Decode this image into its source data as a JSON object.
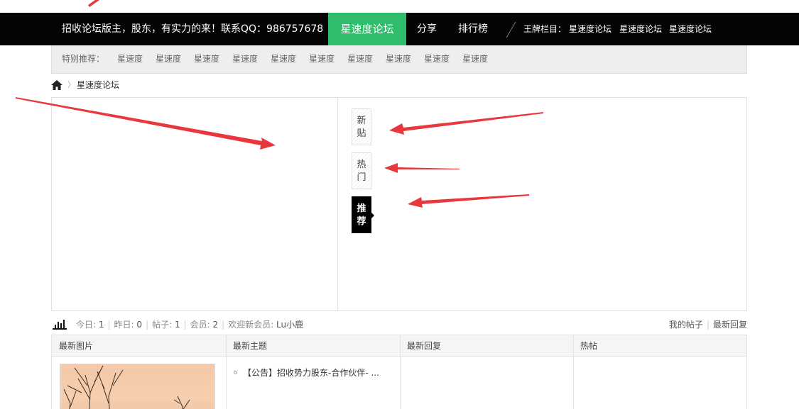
{
  "topbar": {
    "promo": "招收论坛版主，股东，有实力的来！联系QQ：986757678",
    "nav_items": [
      "星速度论坛",
      "分享",
      "排行榜"
    ],
    "ace_label": "王牌栏目：",
    "ace_links": [
      "星速度论坛",
      "星速度论坛",
      "星速度论坛"
    ]
  },
  "subnav": {
    "label": "特别推荐：",
    "links": [
      "星速度",
      "星速度",
      "星速度",
      "星速度",
      "星速度",
      "星速度",
      "星速度",
      "星速度",
      "星速度",
      "星速度"
    ]
  },
  "breadcrumb": {
    "current": "星速度论坛"
  },
  "tabs": {
    "new": [
      "新",
      "贴"
    ],
    "hot": [
      "热",
      "门"
    ],
    "recommend": [
      "推",
      "荐"
    ]
  },
  "stats": {
    "today_label": "今日: ",
    "today": "1",
    "yesterday_label": "昨日: ",
    "yesterday": "0",
    "posts_label": "帖子: ",
    "posts": "1",
    "members_label": "会员: ",
    "members": "2",
    "welcome_label": "欢迎新会员: ",
    "new_member": "Lu小鹿",
    "my_posts": "我的帖子",
    "latest_replies": "最新回复"
  },
  "table": {
    "headers": [
      "最新图片",
      "最新主题",
      "最新回复",
      "热帖"
    ],
    "topics": [
      "【公告】招收势力股东-合作伙伴- ..."
    ]
  },
  "colors": {
    "accent": "#2fbd6c",
    "topbar": "#050505",
    "annotation": "#e8383d"
  }
}
